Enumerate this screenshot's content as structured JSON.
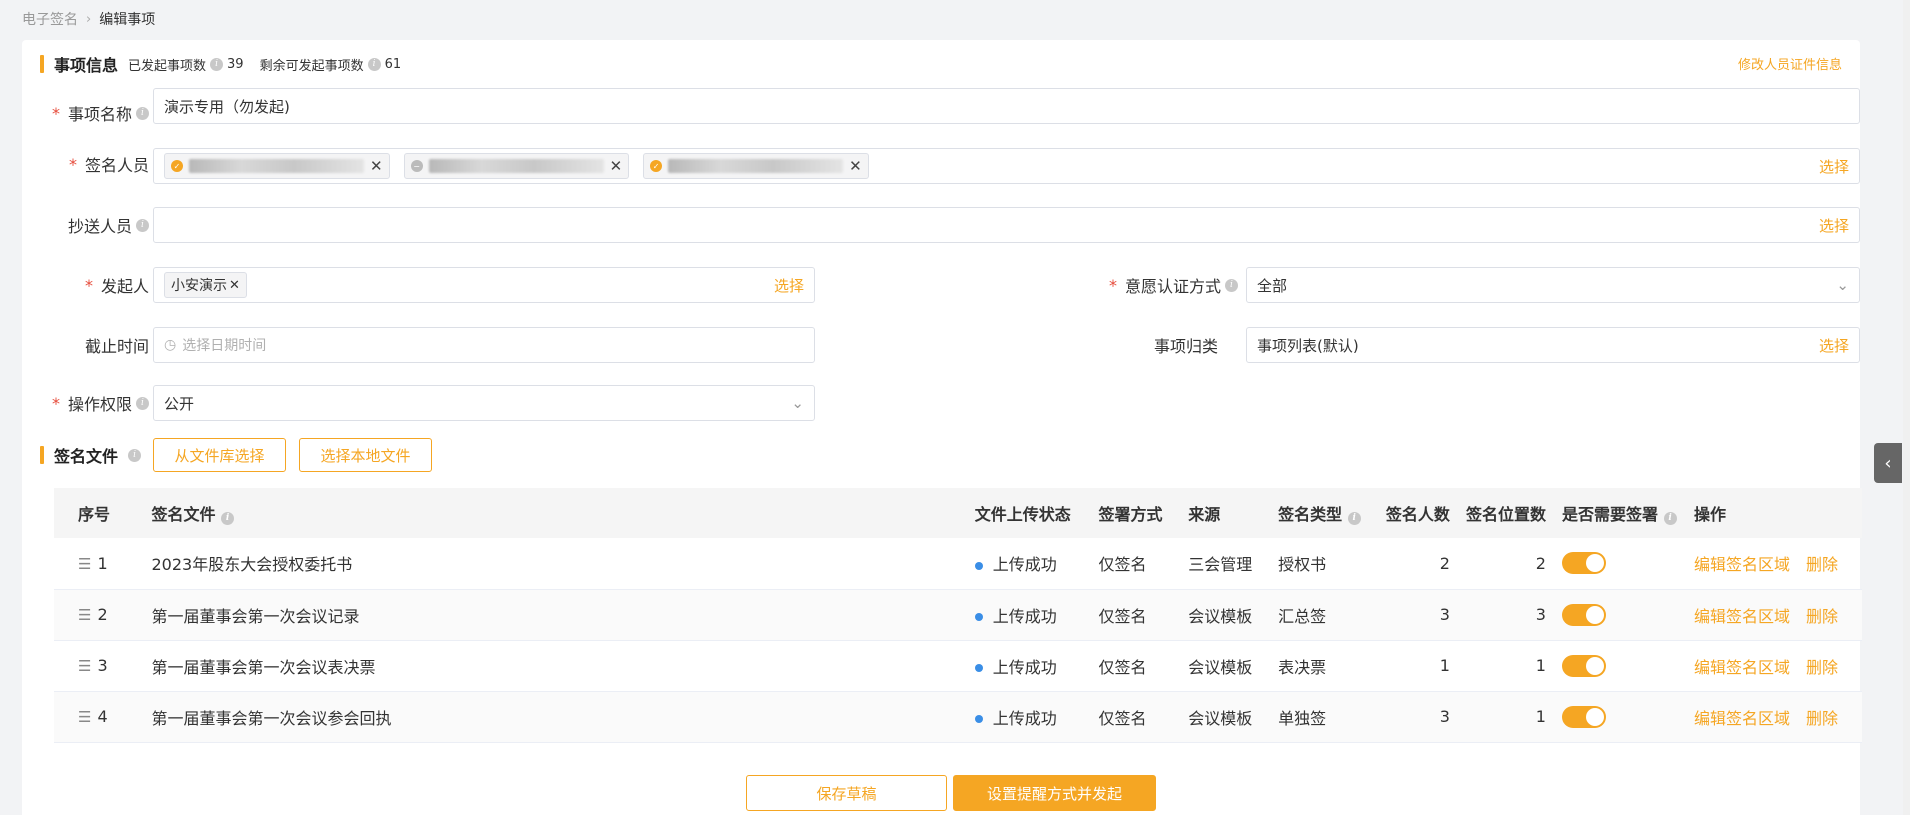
{
  "breadcrumb": {
    "root": "电子签名",
    "separator": "›",
    "current": "编辑事项"
  },
  "info_section": {
    "title": "事项信息",
    "initiated_label": "已发起事项数",
    "initiated_count": "39",
    "remaining_label": "剩余可发起事项数",
    "remaining_count": "61",
    "edit_cert_link": "修改人员证件信息"
  },
  "form": {
    "item_name": {
      "label": "事项名称",
      "value": "演示专用（勿发起)"
    },
    "signers": {
      "label": "签名人员",
      "select": "选择"
    },
    "cc": {
      "label": "抄送人员",
      "select": "选择"
    },
    "initiator": {
      "label": "发起人",
      "tag": "小安演示",
      "select": "选择"
    },
    "auth_method": {
      "label": "意愿认证方式",
      "value": "全部"
    },
    "deadline": {
      "label": "截止时间",
      "placeholder": "选择日期时间"
    },
    "category": {
      "label": "事项归类",
      "value": "事项列表(默认)",
      "select": "选择"
    },
    "permission": {
      "label": "操作权限",
      "value": "公开"
    }
  },
  "files_section": {
    "title": "签名文件",
    "from_library": "从文件库选择",
    "from_local": "选择本地文件"
  },
  "table": {
    "headers": [
      "序号",
      "签名文件",
      "文件上传状态",
      "签署方式",
      "来源",
      "签名类型",
      "签名人数",
      "签名位置数",
      "是否需要签署",
      "操作"
    ],
    "rows": [
      {
        "no": "1",
        "file": "2023年股东大会授权委托书",
        "status": "上传成功",
        "method": "仅签名",
        "source": "三会管理",
        "type": "授权书",
        "signers": "2",
        "positions": "2"
      },
      {
        "no": "2",
        "file": "第一届董事会第一次会议记录",
        "status": "上传成功",
        "method": "仅签名",
        "source": "会议模板",
        "type": "汇总签",
        "signers": "3",
        "positions": "3"
      },
      {
        "no": "3",
        "file": "第一届董事会第一次会议表决票",
        "status": "上传成功",
        "method": "仅签名",
        "source": "会议模板",
        "type": "表决票",
        "signers": "1",
        "positions": "1"
      },
      {
        "no": "4",
        "file": "第一届董事会第一次会议参会回执",
        "status": "上传成功",
        "method": "仅签名",
        "source": "会议模板",
        "type": "单独签",
        "signers": "3",
        "positions": "1"
      }
    ],
    "edit_link": "编辑签名区域",
    "delete_link": "删除"
  },
  "footer": {
    "draft": "保存草稿",
    "submit": "设置提醒方式并发起"
  },
  "colors": {
    "accent": "#f5a623",
    "required": "#e64b3b",
    "status_dot": "#3a8ee6"
  }
}
